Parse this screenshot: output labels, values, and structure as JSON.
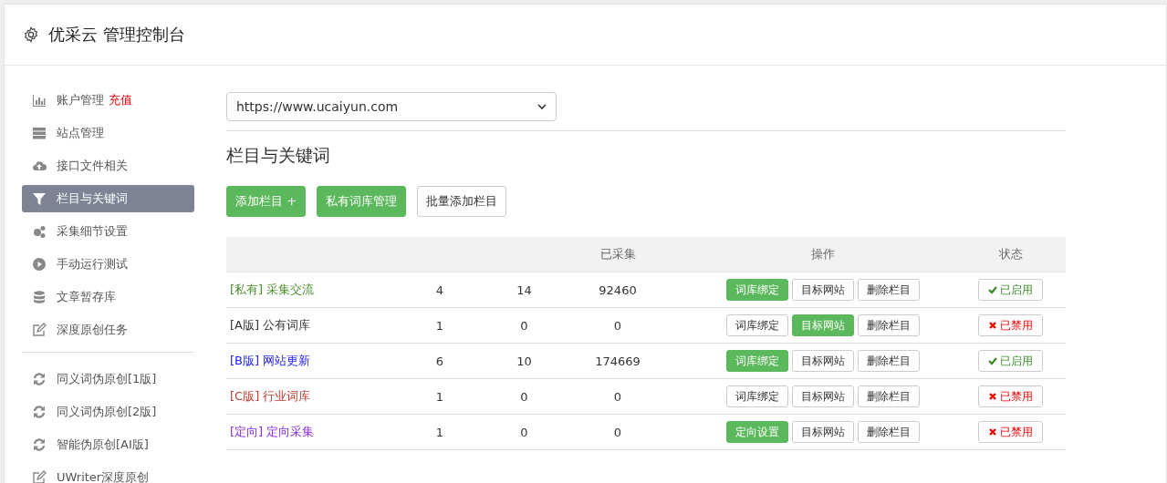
{
  "header": {
    "title": "优采云 管理控制台"
  },
  "sidebar": {
    "items": [
      {
        "label": "账户管理",
        "badge": "充值",
        "selected": false
      },
      {
        "label": "站点管理",
        "selected": false
      },
      {
        "label": "接口文件相关",
        "selected": false
      },
      {
        "label": "栏目与关键词",
        "selected": true
      },
      {
        "label": "采集细节设置",
        "selected": false
      },
      {
        "label": "手动运行测试",
        "selected": false
      },
      {
        "label": "文章暂存库",
        "selected": false
      },
      {
        "label": "深度原创任务",
        "selected": false
      }
    ],
    "items_2": [
      {
        "label": "同义词伪原创[1版]",
        "selected": false
      },
      {
        "label": "同义词伪原创[2版]",
        "selected": false
      },
      {
        "label": "智能伪原创[AI版]",
        "selected": false
      },
      {
        "label": "UWriter深度原创",
        "selected": false
      }
    ]
  },
  "site_select": {
    "value": "https://www.ucaiyun.com"
  },
  "section_title": "栏目与关键词",
  "toolbar": [
    {
      "label": "添加栏目 +",
      "primary": true
    },
    {
      "label": "私有词库管理",
      "primary": true
    },
    {
      "label": "批量添加栏目",
      "primary": false
    }
  ],
  "table": {
    "columns": [
      null,
      null,
      null,
      "已采集",
      "操作",
      "状态"
    ],
    "rows": [
      {
        "tag": "[私有]",
        "name": "采集交流",
        "color": "#4a8a2a",
        "column_2": "4",
        "column_3": "14",
        "collected": "92460",
        "actions": [
          {
            "label": "词库绑定",
            "primary": true
          },
          {
            "label": "目标网站",
            "primary": false
          },
          {
            "label": "删除栏目",
            "primary": false
          }
        ],
        "status": {
          "label": "已启用",
          "enabled": true
        }
      },
      {
        "tag": "[A版]",
        "name": "公有词库",
        "color": "#333333",
        "column_2": "1",
        "column_3": "0",
        "collected": "0",
        "actions": [
          {
            "label": "词库绑定",
            "primary": false
          },
          {
            "label": "目标网站",
            "primary": true
          },
          {
            "label": "删除栏目",
            "primary": false
          }
        ],
        "status": {
          "label": "已禁用",
          "enabled": false
        }
      },
      {
        "tag": "[B版]",
        "name": "网站更新",
        "color": "#1a1aff",
        "column_2": "6",
        "column_3": "10",
        "collected": "174669",
        "actions": [
          {
            "label": "词库绑定",
            "primary": true
          },
          {
            "label": "目标网站",
            "primary": false
          },
          {
            "label": "删除栏目",
            "primary": false
          }
        ],
        "status": {
          "label": "已启用",
          "enabled": true
        }
      },
      {
        "tag": "[C版]",
        "name": "行业词库",
        "color": "#c0392b",
        "column_2": "1",
        "column_3": "0",
        "collected": "0",
        "actions": [
          {
            "label": "词库绑定",
            "primary": false
          },
          {
            "label": "目标网站",
            "primary": false
          },
          {
            "label": "删除栏目",
            "primary": false
          }
        ],
        "status": {
          "label": "已禁用",
          "enabled": false
        }
      },
      {
        "tag": "[定向]",
        "name": "定向采集",
        "color": "#8a2be2",
        "column_2": "1",
        "column_3": "0",
        "collected": "0",
        "actions": [
          {
            "label": "定向设置",
            "primary": true
          },
          {
            "label": "目标网站",
            "primary": false
          },
          {
            "label": "删除栏目",
            "primary": false
          }
        ],
        "status": {
          "label": "已禁用",
          "enabled": false
        }
      }
    ]
  }
}
